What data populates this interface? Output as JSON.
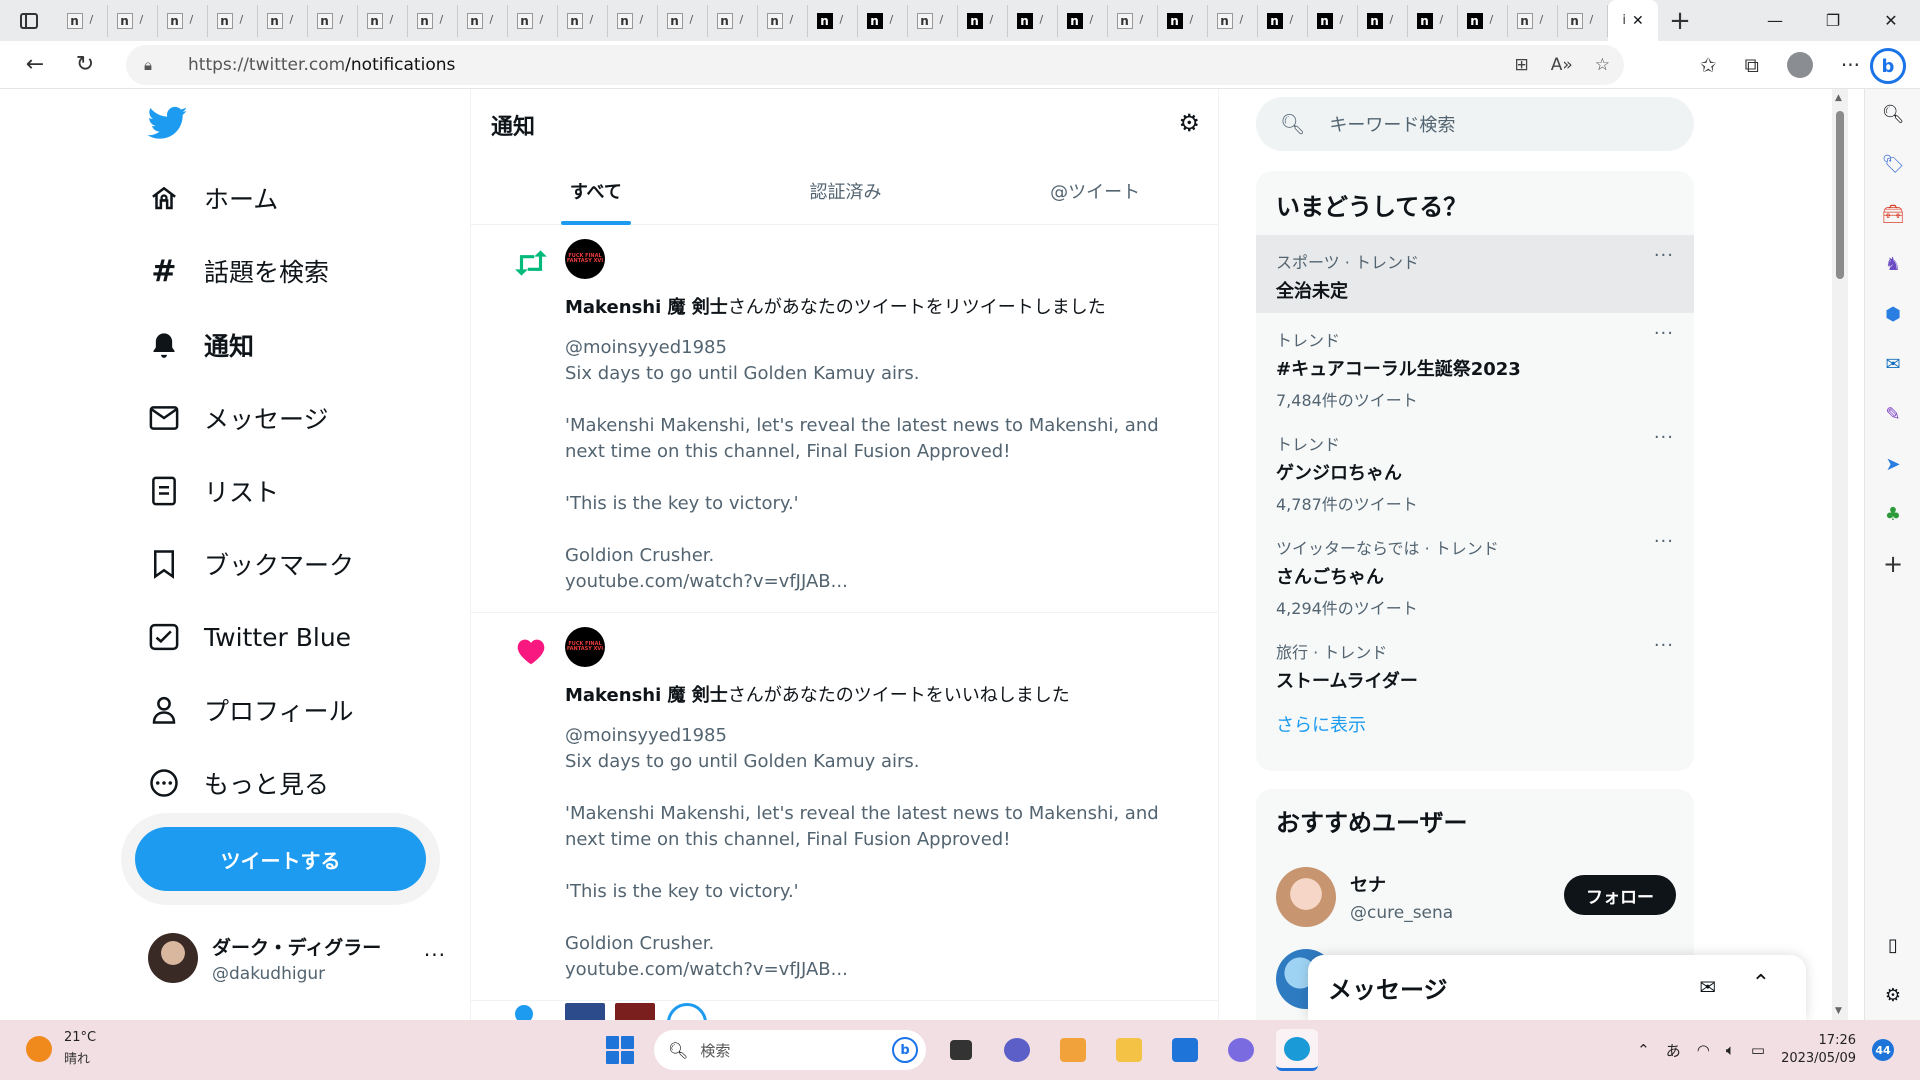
{
  "browser": {
    "url_host": "https://twitter.com",
    "url_path": "/notifications",
    "tab_favicon_letter": "n",
    "tab_count": 31,
    "active_tab_letter": "i"
  },
  "left_nav": {
    "items": [
      {
        "label": "ホーム",
        "icon": "home-icon"
      },
      {
        "label": "話題を検索",
        "icon": "hashtag-icon"
      },
      {
        "label": "通知",
        "icon": "bell-icon",
        "active": true
      },
      {
        "label": "メッセージ",
        "icon": "mail-icon"
      },
      {
        "label": "リスト",
        "icon": "list-icon"
      },
      {
        "label": "ブックマーク",
        "icon": "bookmark-icon"
      },
      {
        "label": "Twitter Blue",
        "icon": "twitter-blue-icon"
      },
      {
        "label": "プロフィール",
        "icon": "profile-icon"
      },
      {
        "label": "もっと見る",
        "icon": "more-circle-icon"
      }
    ],
    "tweet_button": "ツイートする",
    "account": {
      "display_name": "ダーク・ディグラー",
      "handle": "@dakudhigur",
      "more": "···"
    }
  },
  "notifications": {
    "title": "通知",
    "tabs": [
      "すべて",
      "認証済み",
      "@ツイート"
    ],
    "active_tab": 0,
    "items": [
      {
        "kind": "retweet",
        "actor": "Makenshi 魔 剣士",
        "action": "さんがあなたのツイートをリツイートしました",
        "avatar_text": "FUCK FINAL FANTASY XVI",
        "body": "@moinsyyed1985\nSix days to go until Golden Kamuy airs.\n\n'Makenshi Makenshi, let's reveal the latest news to Makenshi, and next time on this channel, Final Fusion Approved!\n\n'This is the key to victory.'\n\nGoldion Crusher.\nyoutube.com/watch?v=vfJJAB..."
      },
      {
        "kind": "like",
        "actor": "Makenshi 魔 剣士",
        "action": "さんがあなたのツイートをいいねしました",
        "avatar_text": "FUCK FINAL FANTASY XVI",
        "body": "@moinsyyed1985\nSix days to go until Golden Kamuy airs.\n\n'Makenshi Makenshi, let's reveal the latest news to Makenshi, and next time on this channel, Final Fusion Approved!\n\n'This is the key to victory.'\n\nGoldion Crusher.\nyoutube.com/watch?v=vfJJAB..."
      }
    ]
  },
  "right": {
    "search_placeholder": "キーワード検索",
    "trends_title": "いまどうしてる？",
    "trends": [
      {
        "category": "スポーツ · トレンド",
        "name": "全治未定",
        "count": ""
      },
      {
        "category": "トレンド",
        "name": "#キュアコーラル生誕祭2023",
        "count": "7,484件のツイート"
      },
      {
        "category": "トレンド",
        "name": "ゲンジロちゃん",
        "count": "4,787件のツイート"
      },
      {
        "category": "ツイッターならでは · トレンド",
        "name": "さんごちゃん",
        "count": "4,294件のツイート"
      },
      {
        "category": "旅行 · トレンド",
        "name": "ストームライダー",
        "count": ""
      }
    ],
    "show_more": "さらに表示",
    "who_title": "おすすめユーザー",
    "suggested_user": {
      "name": "セナ",
      "handle": "@cure_sena",
      "follow": "フォロー"
    },
    "messages_drawer": "メッセージ"
  },
  "taskbar": {
    "temperature": "21°C",
    "weather": "晴れ",
    "search_placeholder": "検索",
    "ime": "あ",
    "time": "17:26",
    "date": "2023/05/09",
    "notification_count": "44"
  },
  "colors": {
    "twitter_blue": "#1d9bf0",
    "retweet_green": "#00ba7c",
    "like_pink": "#f91880"
  }
}
